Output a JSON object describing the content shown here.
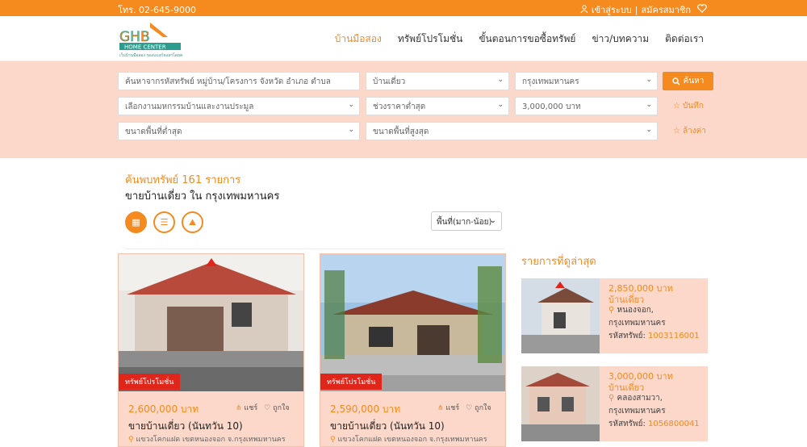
{
  "topbar": {
    "phone": "โทร. 02-645-9000",
    "login": "เข้าสู่ระบบ",
    "register": "สมัครสมาชิก",
    "separator": "|"
  },
  "logo": {
    "text": "GHB",
    "sub": "HOME CENTER",
    "tagline": "เว็บบ้านมือสอง ของแบงก์ธอสฯโดยตรง"
  },
  "nav": [
    "บ้านมือสอง",
    "ทรัพย์โปรโมชั่น",
    "ขั้นตอนการขอซื้อทรัพย์",
    "ข่าว/บทความ",
    "ติดต่อเรา"
  ],
  "search": {
    "keyword_placeholder": "ค้นหาจากรหัสทรัพย์ หมู่บ้าน/โครงการ จังหวัด อำเภอ ตำบล",
    "type": "บ้านเดี่ยว",
    "province": "กรุงเทพมหานคร",
    "search_button": "ค้นหา",
    "event": "เลือกงานมหกรรมบ้านและงานประมูล",
    "price_min": "ช่วงราคาต่ำสุด",
    "price_max": "3,000,000 บาท",
    "save": "บันทึก",
    "area_min": "ขนาดพื้นที่ต่ำสุด",
    "area_max": "ขนาดพื้นที่สูงสุด",
    "clear": "ล้างค่า"
  },
  "results": {
    "count": "ค้นพบทรัพย์ 161 รายการ",
    "title": "ขายบ้านเดี่ยว ใน กรุงเทพมหานคร",
    "sort": "พื้นที่(มาก-น้อย)"
  },
  "cards": [
    {
      "badge": "ทรัพย์โปรโมชั่น",
      "price": "2,600,000 บาท",
      "share": "แชร์",
      "like": "ถูกใจ",
      "title": "ขายบ้านเดี่ยว (นันทวัน 10)",
      "location": "แขวงโคกแฝด เขตหนองจอก จ.กรุงเทพมหานคร"
    },
    {
      "badge": "ทรัพย์โปรโมชั่น",
      "price": "2,590,000 บาท",
      "share": "แชร์",
      "like": "ถูกใจ",
      "title": "ขายบ้านเดี่ยว (นันทวัน 10)",
      "location": "แขวงโคกแฝด เขตหนองจอก จ.กรุงเทพมหานคร"
    }
  ],
  "latest": {
    "heading": "รายการที่ดูล่าสุด",
    "items": [
      {
        "price": "2,850,000 บาท",
        "type": "บ้านเดี่ยว",
        "loc1": "หนองจอก,",
        "loc2": "กรุงเทพมหานคร",
        "code_label": "รหัสทรัพย์:",
        "code": "1003116001"
      },
      {
        "price": "3,000,000 บาท",
        "type": "บ้านเดี่ยว",
        "loc1": "คลองสามวา,",
        "loc2": "กรุงเทพมหานคร",
        "code_label": "รหัสทรัพย์:",
        "code": "1056800041"
      }
    ]
  },
  "colors": {
    "accent": "#f58a1f",
    "badge": "#e0261b",
    "panel": "#fbd8c9"
  }
}
